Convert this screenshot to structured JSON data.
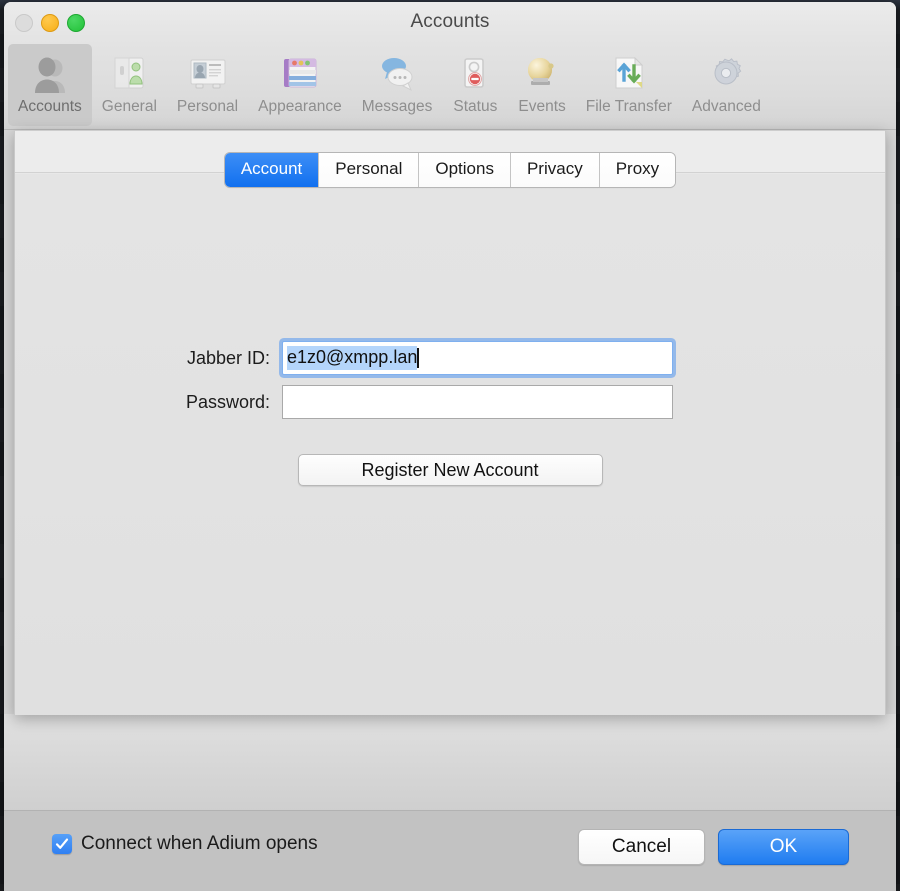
{
  "window": {
    "title": "Accounts",
    "traffic_lights": [
      {
        "name": "close",
        "color": "#dcdcdc"
      },
      {
        "name": "minimize",
        "color": "#f7ae18"
      },
      {
        "name": "zoom",
        "color": "#22c138"
      }
    ]
  },
  "toolbar": {
    "items": [
      {
        "label": "Accounts",
        "icon": "accounts-icon",
        "selected": true
      },
      {
        "label": "General",
        "icon": "general-icon",
        "selected": false
      },
      {
        "label": "Personal",
        "icon": "personal-icon",
        "selected": false
      },
      {
        "label": "Appearance",
        "icon": "appearance-icon",
        "selected": false
      },
      {
        "label": "Messages",
        "icon": "messages-icon",
        "selected": false
      },
      {
        "label": "Status",
        "icon": "status-icon",
        "selected": false
      },
      {
        "label": "Events",
        "icon": "events-icon",
        "selected": false
      },
      {
        "label": "File Transfer",
        "icon": "file-transfer-icon",
        "selected": false
      },
      {
        "label": "Advanced",
        "icon": "advanced-icon",
        "selected": false
      }
    ]
  },
  "sheet": {
    "tabs": [
      {
        "label": "Account",
        "active": true
      },
      {
        "label": "Personal",
        "active": false
      },
      {
        "label": "Options",
        "active": false
      },
      {
        "label": "Privacy",
        "active": false
      },
      {
        "label": "Proxy",
        "active": false
      }
    ],
    "form": {
      "jabber_id_label": "Jabber ID:",
      "jabber_id_value": "e1z0@xmpp.lan",
      "jabber_id_placeholder": "",
      "password_label": "Password:",
      "password_value": "",
      "password_placeholder": "",
      "register_button": "Register New Account"
    }
  },
  "bottom_bar": {
    "connect_checkbox_label": "Connect when Adium opens",
    "connect_checkbox_checked": true,
    "cancel_label": "Cancel",
    "ok_label": "OK"
  },
  "colors": {
    "accent": "#1f7cf0",
    "selection": "#b4d5fb",
    "tab_active": "#1170ef",
    "window_bg": "#d6d6d6"
  }
}
